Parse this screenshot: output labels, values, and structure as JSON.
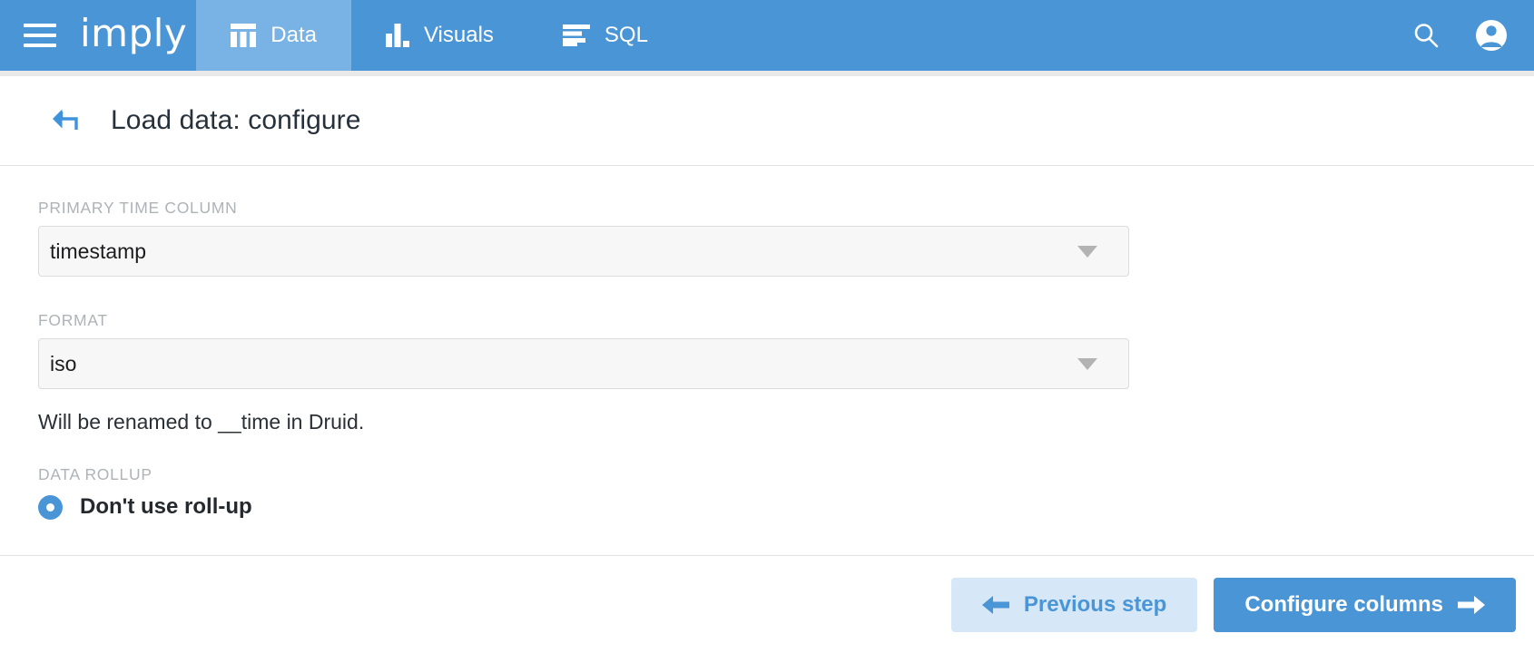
{
  "topnav": {
    "menu_icon": "hamburger-menu-icon",
    "brand": "imply",
    "tabs": [
      {
        "label": "Data",
        "icon": "table-columns-icon",
        "active": true
      },
      {
        "label": "Visuals",
        "icon": "bar-chart-icon",
        "active": false
      },
      {
        "label": "SQL",
        "icon": "text-lines-icon",
        "active": false
      }
    ],
    "actions": [
      {
        "icon": "search-icon",
        "name": "search-button"
      },
      {
        "icon": "user-account-icon",
        "name": "account-button"
      }
    ]
  },
  "page": {
    "back_icon": "back-arrow-icon",
    "title": "Load data: configure"
  },
  "form": {
    "primary_time_column": {
      "label": "PRIMARY TIME COLUMN",
      "value": "timestamp",
      "caret_icon": "chevron-down-icon"
    },
    "format": {
      "label": "FORMAT",
      "value": "iso",
      "caret_icon": "chevron-down-icon"
    },
    "helper_text": "Will be renamed to __time in Druid.",
    "data_rollup": {
      "label": "DATA ROLLUP",
      "option_label": "Don't use roll-up",
      "selected": true
    }
  },
  "footer": {
    "previous_label": "Previous step",
    "previous_icon": "arrow-left-icon",
    "next_label": "Configure columns",
    "next_icon": "arrow-right-icon"
  },
  "colors": {
    "header_blue": "#4a95d6",
    "active_tab_blue": "#79b2e4",
    "accent": "#4a95d6",
    "secondary_button_bg": "#d6e8f8",
    "label_gray": "#aeb3b8",
    "field_bg": "#f7f7f7"
  }
}
